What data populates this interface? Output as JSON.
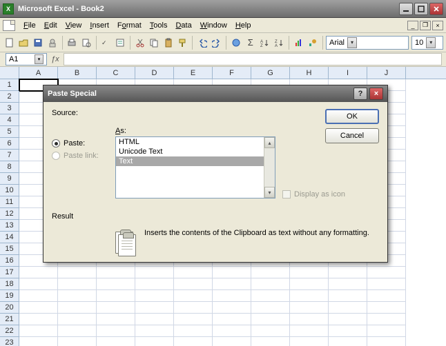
{
  "title": "Microsoft Excel - Book2",
  "menu": [
    "File",
    "Edit",
    "View",
    "Insert",
    "Format",
    "Tools",
    "Data",
    "Window",
    "Help"
  ],
  "font_name": "Arial",
  "font_size": "10",
  "namebox": "A1",
  "columns": [
    "A",
    "B",
    "C",
    "D",
    "E",
    "F",
    "G",
    "H",
    "I",
    "J"
  ],
  "rows": [
    "1",
    "2",
    "3",
    "4",
    "5",
    "6",
    "7",
    "8",
    "9",
    "10",
    "11",
    "12",
    "13",
    "14",
    "15",
    "16",
    "17",
    "18",
    "19",
    "20",
    "21",
    "22",
    "23"
  ],
  "selected_cell": "A1",
  "dialog": {
    "title": "Paste Special",
    "source_label": "Source:",
    "as_label": "As:",
    "paste_label": "Paste:",
    "paste_link_label": "Paste link:",
    "list": [
      "HTML",
      "Unicode Text",
      "Text"
    ],
    "selected": "Text",
    "display_icon_label": "Display as icon",
    "result_label": "Result",
    "result_text": "Inserts the contents of the Clipboard as text without any formatting.",
    "ok": "OK",
    "cancel": "Cancel"
  }
}
